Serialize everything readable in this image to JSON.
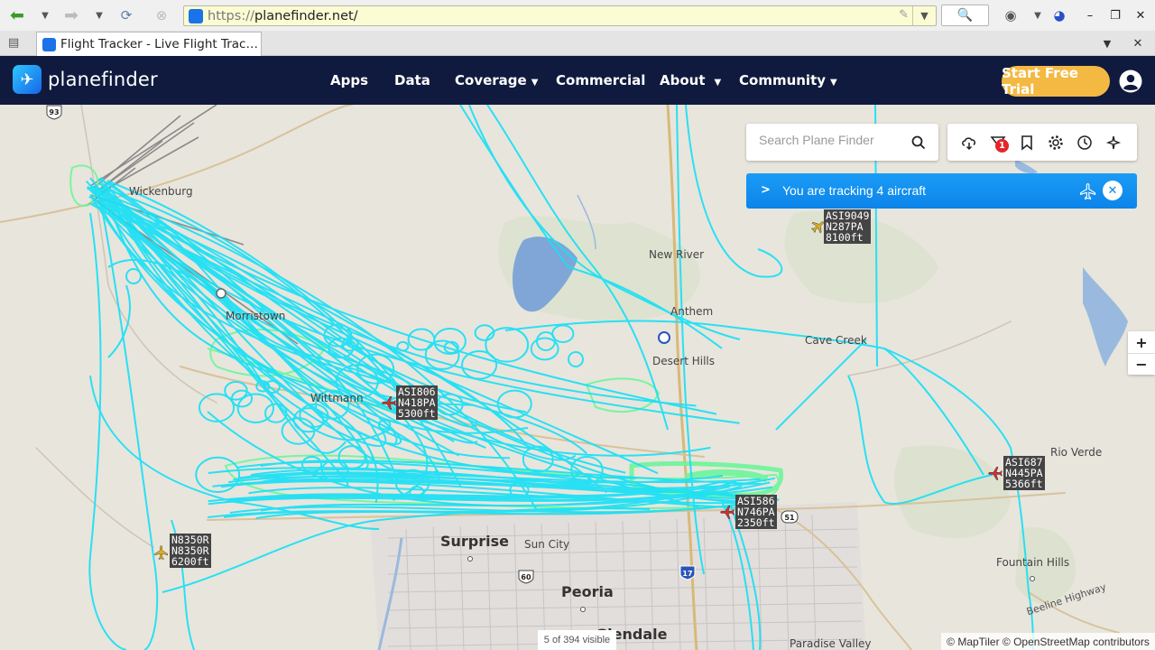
{
  "browser": {
    "url_protocol": "https://",
    "url_host": "planefinder.net/",
    "tab_title": "Flight Tracker - Live Flight Trac…"
  },
  "site": {
    "logo_text": "planefinder",
    "nav": [
      {
        "label": "Apps",
        "has_menu": false
      },
      {
        "label": "Data",
        "has_menu": false
      },
      {
        "label": "Coverage",
        "has_menu": true
      },
      {
        "label": "Commercial",
        "has_menu": false
      },
      {
        "label": "About",
        "has_menu": true
      },
      {
        "label": "Community",
        "has_menu": true
      }
    ],
    "cta_label": "Start Free Trial"
  },
  "map": {
    "search_placeholder": "Search Plane Finder",
    "filter_badge": "1",
    "tracking_message": "You are tracking 4 aircraft",
    "visible_count": "5 of 394 visible",
    "attribution": "© MapTiler © OpenStreetMap contributors",
    "zoom_in": "+",
    "zoom_out": "−",
    "track_color": "#19e0f5",
    "track_low_color": "#6ef59a",
    "cities": [
      {
        "name": "Wickenburg",
        "size": "small"
      },
      {
        "name": "New River",
        "size": "small"
      },
      {
        "name": "Morristown",
        "size": "small"
      },
      {
        "name": "Anthem",
        "size": "small"
      },
      {
        "name": "Desert Hills",
        "size": "small"
      },
      {
        "name": "Cave Creek",
        "size": "small"
      },
      {
        "name": "Wittmann",
        "size": "small"
      },
      {
        "name": "Rio Verde",
        "size": "small"
      },
      {
        "name": "Surprise",
        "size": "big"
      },
      {
        "name": "Sun City",
        "size": "small"
      },
      {
        "name": "Peoria",
        "size": "big"
      },
      {
        "name": "Glendale",
        "size": "big"
      },
      {
        "name": "Fountain Hills",
        "size": "small"
      },
      {
        "name": "Paradise Valley",
        "size": "small"
      },
      {
        "name": "Beeline Highway",
        "size": "small"
      }
    ],
    "shields": [
      "93",
      "60",
      "17",
      "51"
    ],
    "aircraft": [
      {
        "callsign": "ASI9049",
        "reg": "N287PA",
        "alt": "8100ft",
        "color": "#e0b020"
      },
      {
        "callsign": "ASI806",
        "reg": "N418PA",
        "alt": "5300ft",
        "color": "#d03030"
      },
      {
        "callsign": "ASI687",
        "reg": "N445PA",
        "alt": "5366ft",
        "color": "#d03030"
      },
      {
        "callsign": "ASI586",
        "reg": "N746PA",
        "alt": "2350ft",
        "color": "#d03030"
      },
      {
        "callsign": "N8350R",
        "reg": "N8350R",
        "alt": "6200ft",
        "color": "#e0b020"
      }
    ]
  }
}
